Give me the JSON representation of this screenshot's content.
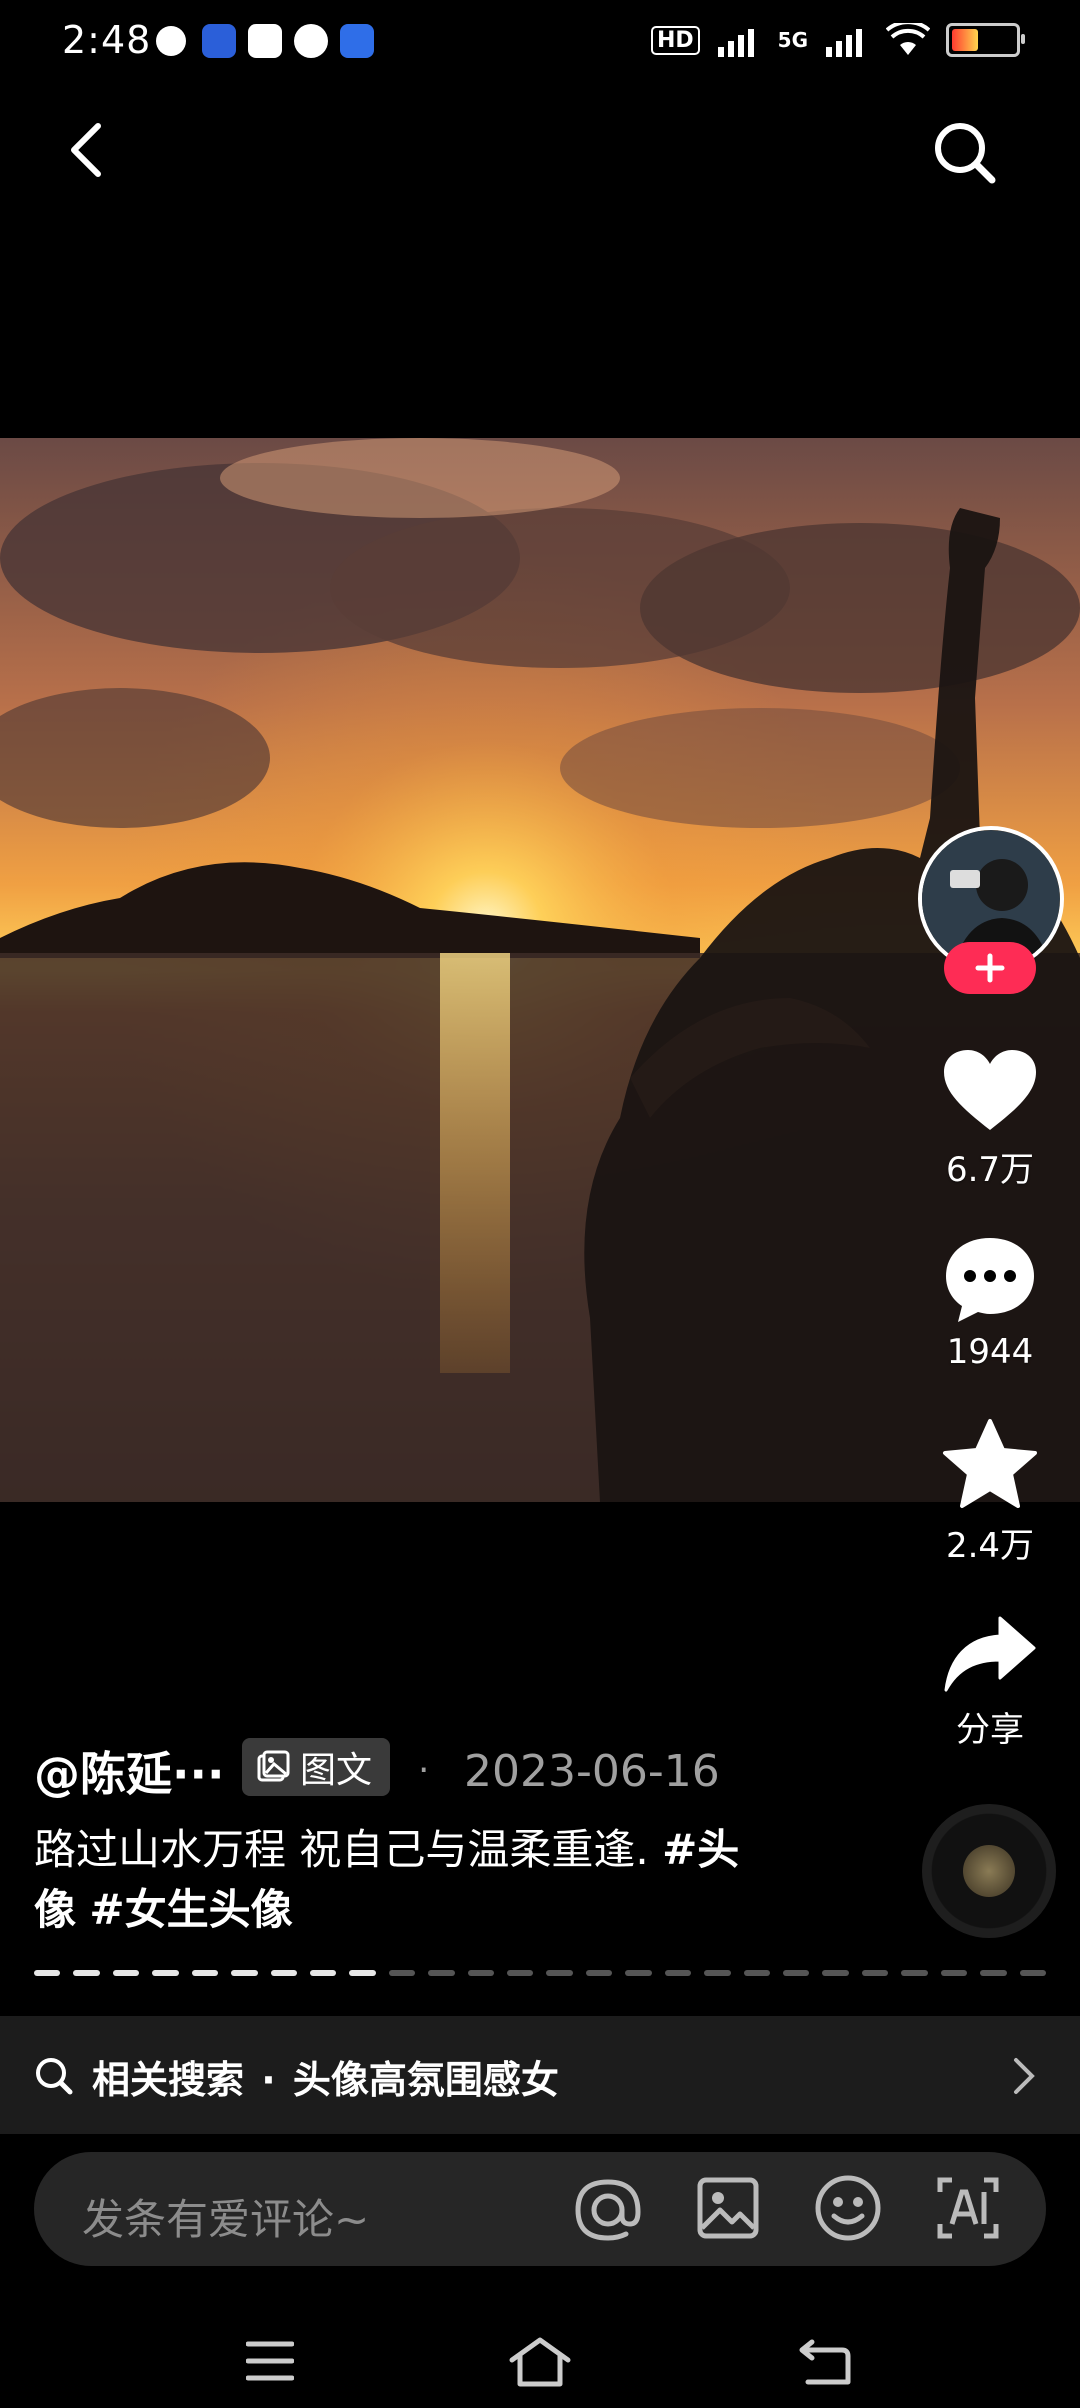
{
  "status_bar": {
    "time": "2:48",
    "network_1": "HD",
    "network_2": "5G"
  },
  "post": {
    "author": "@陈延···",
    "type_label": "图文",
    "separator": "·",
    "date": "2023-06-16",
    "caption_text": "路过山水万程 祝自己与温柔重逢. ",
    "hashtag_1": "#头像",
    "hashtag_2": "#女生头像",
    "image_count": 26,
    "current_image": 9
  },
  "actions": {
    "likes": "6.7万",
    "comments": "1944",
    "favorites": "2.4万",
    "share": "分享"
  },
  "related_search": {
    "prefix": "相关搜索",
    "dot": "·",
    "query": "头像高氛围感女"
  },
  "comment_input": {
    "placeholder": "发条有爱评论~"
  },
  "icons": {
    "back": "back-chevron-icon",
    "search": "search-icon",
    "like": "heart-icon",
    "comment": "comment-bubble-icon",
    "favorite": "star-icon",
    "share": "share-arrow-icon",
    "mention": "at-icon",
    "image": "image-icon",
    "emoji": "emoji-icon",
    "ai": "ai-icon",
    "menu": "menu-icon",
    "home": "home-icon",
    "back_nav": "return-icon"
  },
  "colors": {
    "accent": "#fe2c55",
    "background": "#000000"
  }
}
